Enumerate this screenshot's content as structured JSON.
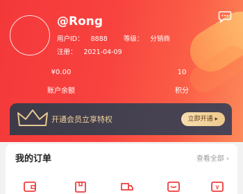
{
  "profile": {
    "username": "@Rong",
    "user_id_label": "用户ID：",
    "user_id": "8888",
    "level_label": "等级：",
    "level": "分销商",
    "register_label": "注册：",
    "register_date": "2021-04-09"
  },
  "stats": {
    "balance_value": "¥0.00",
    "balance_label": "账户余额",
    "points_value": "10",
    "points_label": "积分"
  },
  "vip": {
    "text": "开通会员立享特权",
    "button": "立即开通 ▸"
  },
  "orders": {
    "title": "我的订单",
    "view_all": "查看全部 ›",
    "icons": [
      "wallet-icon",
      "package-icon",
      "truck-icon",
      "inbox-icon",
      "refund-icon"
    ]
  },
  "colors": {
    "header_red": "#f4383a",
    "order_icon_red": "#ef3b3a",
    "vip_gold": "#f2d39c"
  }
}
